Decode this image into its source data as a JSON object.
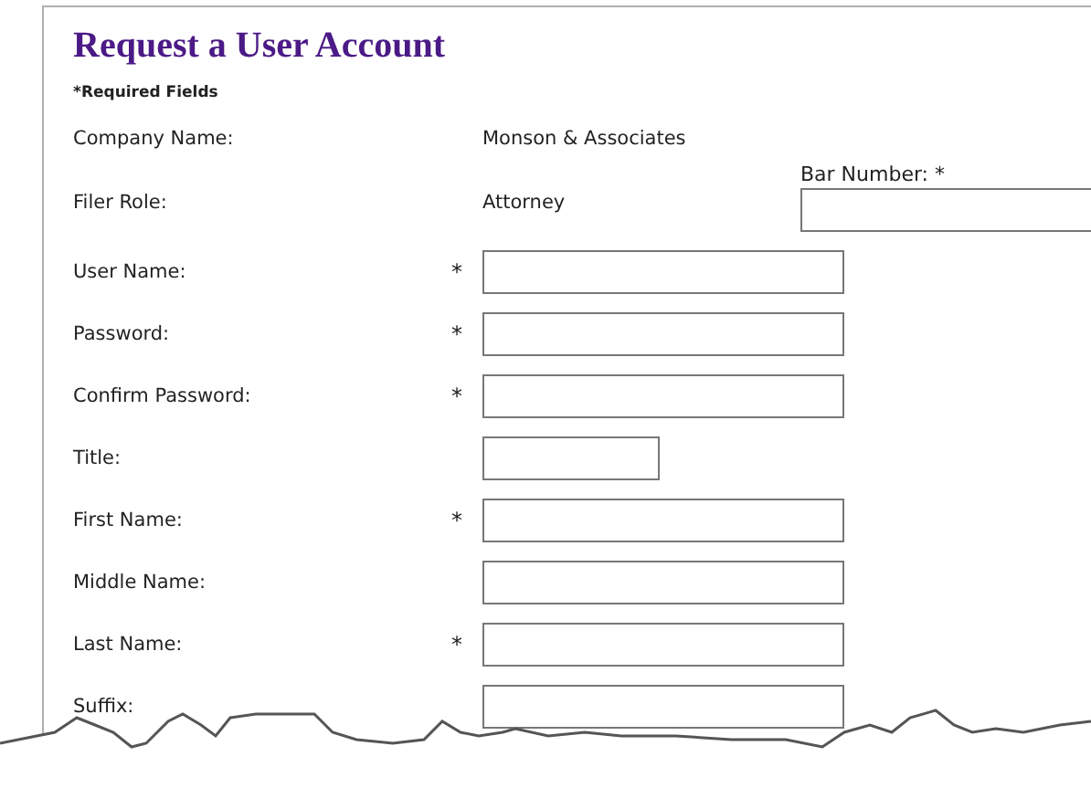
{
  "title": "Request a User Account",
  "required_note": "*Required Fields",
  "info": [
    {
      "label": "Company Name:",
      "value": "Monson & Associates"
    },
    {
      "label": "Filer Role:",
      "value": "Attorney",
      "extra": {
        "label": "Bar Number: *"
      }
    }
  ],
  "required_mark": "*",
  "fields": [
    {
      "label": "User Name:",
      "required": true,
      "kind": "long"
    },
    {
      "label": "Password:",
      "required": true,
      "kind": "long"
    },
    {
      "label": "Confirm Password:",
      "required": true,
      "kind": "long"
    },
    {
      "label": "Title:",
      "required": false,
      "kind": "short"
    },
    {
      "label": "First Name:",
      "required": true,
      "kind": "long"
    },
    {
      "label": "Middle Name:",
      "required": false,
      "kind": "long"
    },
    {
      "label": "Last Name:",
      "required": true,
      "kind": "long"
    },
    {
      "label": "Suffix:",
      "required": false,
      "kind": "long"
    }
  ]
}
